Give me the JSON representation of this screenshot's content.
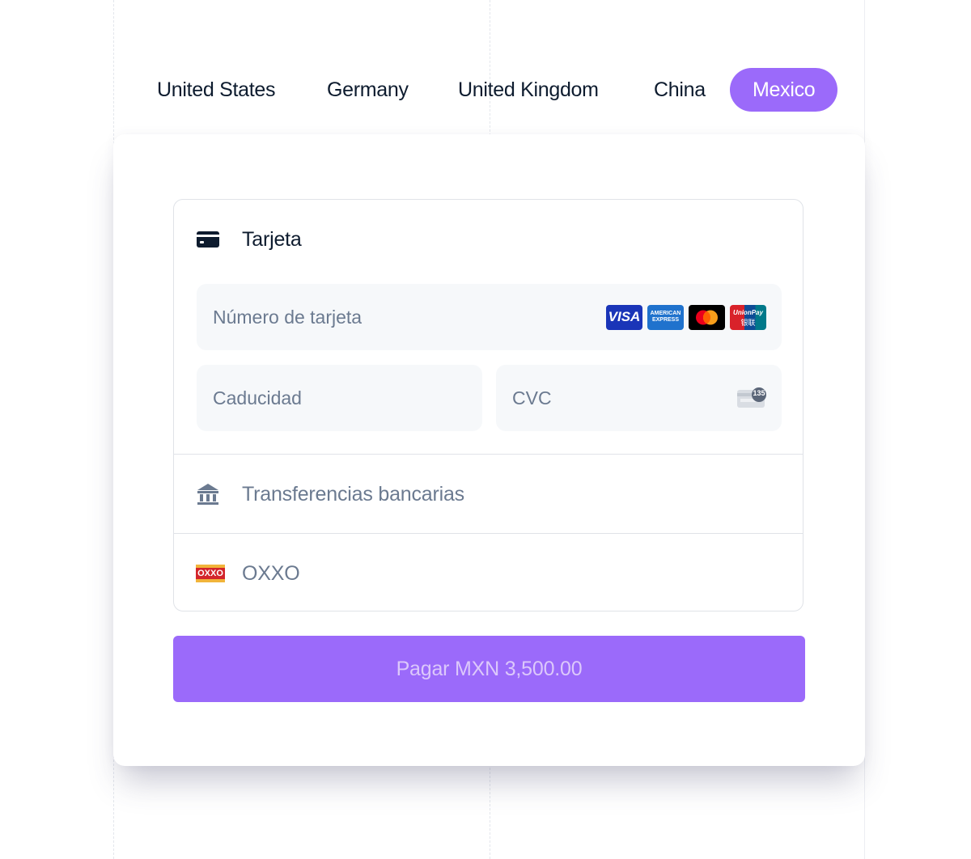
{
  "tabs": [
    {
      "label": "United States",
      "active": false
    },
    {
      "label": "Germany",
      "active": false
    },
    {
      "label": "United Kingdom",
      "active": false
    },
    {
      "label": "China",
      "active": false
    },
    {
      "label": "Mexico",
      "active": true
    }
  ],
  "payment": {
    "card": {
      "label": "Tarjeta",
      "icon": "card-icon",
      "number_placeholder": "Número de tarjeta",
      "expiry_placeholder": "Caducidad",
      "cvc_placeholder": "CVC",
      "cvc_icon_badge": "135",
      "brands": [
        "VISA",
        "AMERICAN EXPRESS",
        "Mastercard",
        "UnionPay"
      ],
      "brand_texts": {
        "visa": "VISA",
        "amex_line1": "AMERICAN",
        "amex_line2": "EXPRESS",
        "unionpay_line1": "UnionPay",
        "unionpay_line2": "银联"
      }
    },
    "bank_transfer": {
      "label": "Transferencias bancarias",
      "icon": "bank-icon"
    },
    "oxxo": {
      "label": "OXXO",
      "icon": "oxxo-icon",
      "logo_text": "OXXO"
    }
  },
  "pay_button": {
    "label": "Pagar MXN 3,500.00"
  },
  "colors": {
    "accent": "#9b6afa",
    "text_dark": "#0d1b2e",
    "text_muted": "#6b7a90",
    "field_bg": "#f6f8fa"
  }
}
